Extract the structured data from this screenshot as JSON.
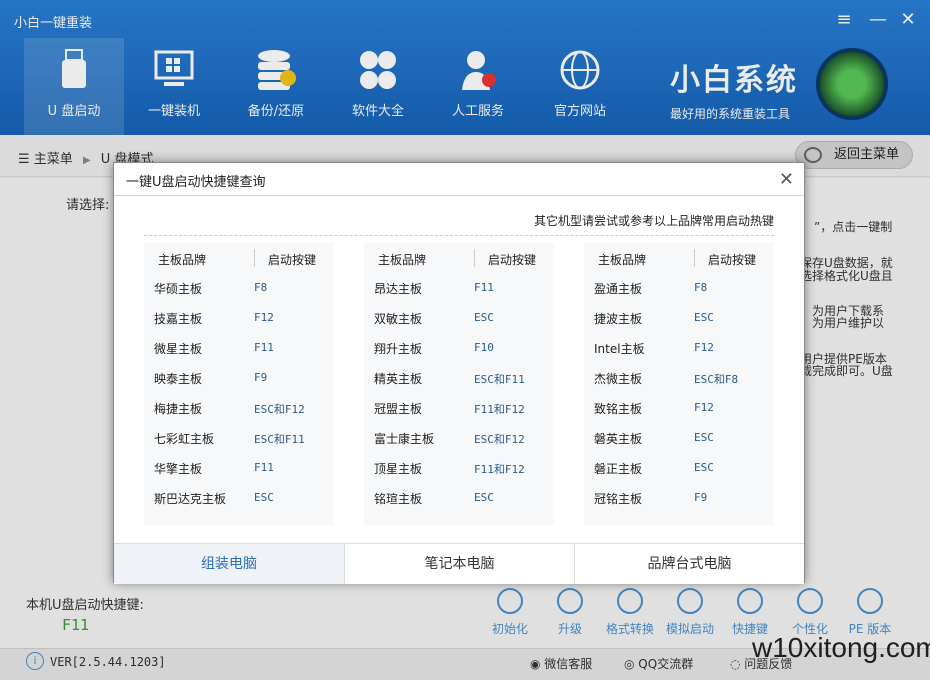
{
  "app": {
    "title": "小白一键重装",
    "menu_icon": "≡",
    "min_icon": "—",
    "close_icon": "✕"
  },
  "nav": [
    {
      "label": "U 盘启动",
      "icon": "usb-icon"
    },
    {
      "label": "一键装机",
      "icon": "monitor-icon"
    },
    {
      "label": "备份/还原",
      "icon": "database-icon"
    },
    {
      "label": "软件大全",
      "icon": "apps-icon"
    },
    {
      "label": "人工服务",
      "icon": "user-heart-icon"
    },
    {
      "label": "官方网站",
      "icon": "globe-icon"
    }
  ],
  "brand": {
    "name": "小白系统",
    "slogan": "最好用的系统重装工具"
  },
  "breadcrumb": {
    "root": "主菜单",
    "sep": "▶",
    "current": "U 盘模式"
  },
  "back_button": "返回主菜单",
  "main": {
    "select_label": "请选择:",
    "right_lines": [
      "”，点击一键制",
      "保存U盘数据，就",
      "选择格式化U盘且",
      "为用户下载系",
      "为用户维护以",
      "用户提供PE版本",
      "载完成即可。U盘"
    ]
  },
  "dialog": {
    "title": "一键U盘启动快捷键查询",
    "close": "✕",
    "note": "其它机型请尝试或参考以上品牌常用启动热键",
    "headers": {
      "brand": "主板品牌",
      "key": "启动按键"
    },
    "columns": [
      [
        {
          "brand": "华硕主板",
          "key": "F8"
        },
        {
          "brand": "技嘉主板",
          "key": "F12"
        },
        {
          "brand": "微星主板",
          "key": "F11"
        },
        {
          "brand": "映泰主板",
          "key": "F9"
        },
        {
          "brand": "梅捷主板",
          "key": "ESC和F12"
        },
        {
          "brand": "七彩虹主板",
          "key": "ESC和F11"
        },
        {
          "brand": "华擎主板",
          "key": "F11"
        },
        {
          "brand": "斯巴达克主板",
          "key": "ESC"
        }
      ],
      [
        {
          "brand": "昂达主板",
          "key": "F11"
        },
        {
          "brand": "双敏主板",
          "key": "ESC"
        },
        {
          "brand": "翔升主板",
          "key": "F10"
        },
        {
          "brand": "精英主板",
          "key": "ESC和F11"
        },
        {
          "brand": "冠盟主板",
          "key": "F11和F12"
        },
        {
          "brand": "富士康主板",
          "key": "ESC和F12"
        },
        {
          "brand": "顶星主板",
          "key": "F11和F12"
        },
        {
          "brand": "铭瑄主板",
          "key": "ESC"
        }
      ],
      [
        {
          "brand": "盈通主板",
          "key": "F8"
        },
        {
          "brand": "捷波主板",
          "key": "ESC"
        },
        {
          "brand": "Intel主板",
          "key": "F12"
        },
        {
          "brand": "杰微主板",
          "key": "ESC和F8"
        },
        {
          "brand": "致铭主板",
          "key": "F12"
        },
        {
          "brand": "磐英主板",
          "key": "ESC"
        },
        {
          "brand": "磐正主板",
          "key": "ESC"
        },
        {
          "brand": "冠铭主板",
          "key": "F9"
        }
      ]
    ],
    "tabs": [
      "组装电脑",
      "笔记本电脑",
      "品牌台式电脑"
    ]
  },
  "bottom": {
    "shortcut_label": "本机U盘启动快捷键:",
    "shortcut_key": "F11",
    "actions": [
      "初始化",
      "升级",
      "格式转换",
      "模拟启动",
      "快捷键",
      "个性化",
      "PE 版本"
    ]
  },
  "status": {
    "version": "VER[2.5.44.1203]",
    "wechat": "微信客服",
    "qq": "QQ交流群",
    "feedback": "问题反馈",
    "watermark": "w10xitong.com"
  },
  "colors": {
    "header": "#1f6fc5",
    "accent": "#4a90d0",
    "key_green": "#3a9a3a"
  }
}
